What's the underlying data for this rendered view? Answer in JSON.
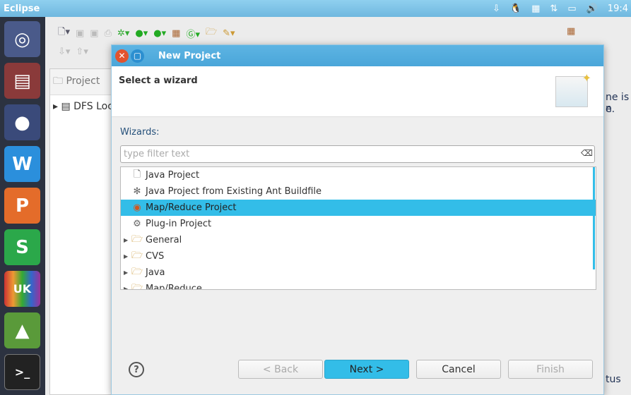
{
  "topbar": {
    "app_title": "Eclipse",
    "clock": "19:4",
    "tray_icons": [
      "download-icon",
      "tux-icon",
      "calendar-icon",
      "network-icon",
      "battery-icon",
      "volume-icon"
    ]
  },
  "launcher": {
    "items": [
      "ubuntu-dash",
      "files",
      "firefox",
      "wps-writer",
      "wps-presentation",
      "wps-spreadsheet",
      "ubuntu-kylin",
      "software-center",
      "terminal"
    ],
    "uk_label": "UK"
  },
  "eclipse": {
    "project_tab": "Project",
    "dfs_item": "DFS Loc",
    "right_text_1": "ne is n",
    "right_text_2": "e.",
    "right_text_3": "tus"
  },
  "dialog": {
    "title": "New Project",
    "header": "Select a wizard",
    "wizards_label": "Wizards:",
    "filter_placeholder": "type filter text",
    "filter_value": "",
    "items": [
      {
        "label": "Java Project",
        "icon": "java-project-icon",
        "expandable": false,
        "selected": false
      },
      {
        "label": "Java Project from Existing Ant Buildfile",
        "icon": "ant-icon",
        "expandable": false,
        "selected": false
      },
      {
        "label": "Map/Reduce Project",
        "icon": "mapreduce-icon",
        "expandable": false,
        "selected": true
      },
      {
        "label": "Plug-in Project",
        "icon": "plugin-icon",
        "expandable": false,
        "selected": false
      },
      {
        "label": "General",
        "icon": "folder-icon",
        "expandable": true,
        "selected": false
      },
      {
        "label": "CVS",
        "icon": "folder-icon",
        "expandable": true,
        "selected": false
      },
      {
        "label": "Java",
        "icon": "folder-icon",
        "expandable": true,
        "selected": false
      },
      {
        "label": "Map/Reduce",
        "icon": "folder-icon",
        "expandable": true,
        "selected": false
      }
    ],
    "buttons": {
      "help": "?",
      "back": "< Back",
      "next": "Next >",
      "cancel": "Cancel",
      "finish": "Finish"
    }
  },
  "colors": {
    "accent": "#33bde8",
    "titlebar": "#4aa6d9",
    "close": "#e2532e"
  }
}
